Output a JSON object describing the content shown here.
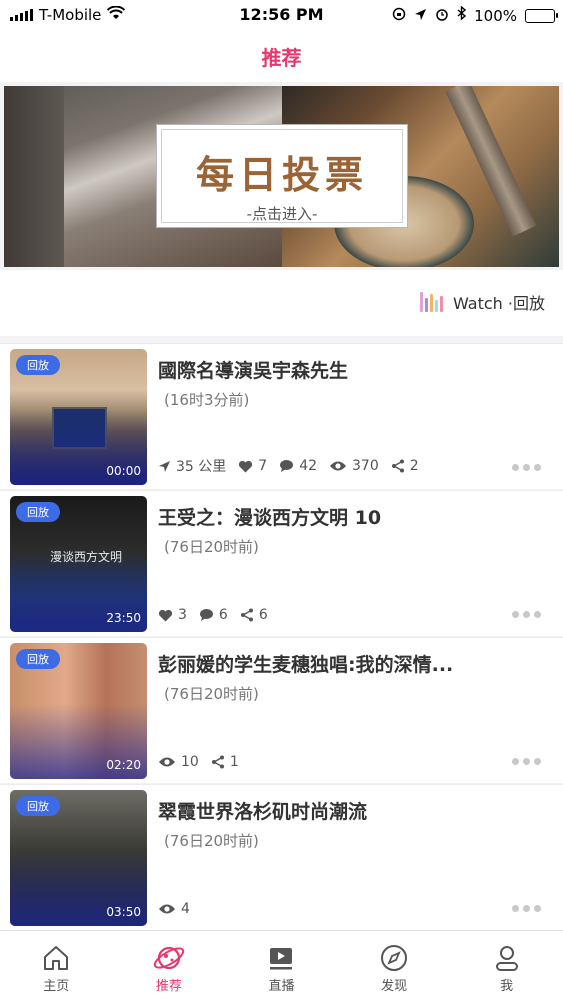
{
  "status_bar": {
    "carrier": "T-Mobile",
    "time": "12:56 PM",
    "battery": "100%"
  },
  "nav": {
    "title": "推荐"
  },
  "banner": {
    "title": "每日投票",
    "subtitle": "-点击进入-"
  },
  "watch": {
    "label": "Watch ·回放",
    "colors": [
      "#e4a0d4",
      "#9b8ff0",
      "#f3b46a",
      "#9bdaef",
      "#f18cae"
    ]
  },
  "items": [
    {
      "badge": "回放",
      "duration": "00:00",
      "title": "國際名導演吳宇森先生",
      "time": "(16时3分前)",
      "distance": "35 公里",
      "likes": "7",
      "comments": "42",
      "views": "370",
      "shares": "2"
    },
    {
      "badge": "回放",
      "duration": "23:50",
      "thumb_caption": "漫谈西方文明",
      "title": "王受之：漫谈西方文明 10",
      "time": "(76日20时前)",
      "likes": "3",
      "comments": "6",
      "shares": "6"
    },
    {
      "badge": "回放",
      "duration": "02:20",
      "title": "彭丽媛的学生麦穗独唱:我的深情...",
      "time": "(76日20时前)",
      "views": "10",
      "shares": "1"
    },
    {
      "badge": "回放",
      "duration": "03:50",
      "title": "翠霞世界洛杉矶时尚潮流",
      "time": "(76日20时前)",
      "views": "4"
    }
  ],
  "tabbar": {
    "tabs": [
      {
        "label": "主页",
        "icon": "home-icon"
      },
      {
        "label": "推荐",
        "icon": "planet-icon"
      },
      {
        "label": "直播",
        "icon": "play-box-icon"
      },
      {
        "label": "发现",
        "icon": "compass-icon"
      },
      {
        "label": "我",
        "icon": "person-icon"
      }
    ],
    "active_color": "#e5396e"
  }
}
